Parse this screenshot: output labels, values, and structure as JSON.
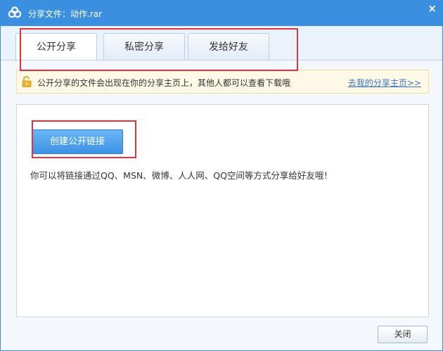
{
  "window": {
    "title": "分享文件：动作.rar",
    "close_glyph": "×",
    "icon": "baidu-cloud-logo-icon"
  },
  "tabs": [
    {
      "label": "公开分享",
      "active": true
    },
    {
      "label": "私密分享",
      "active": false
    },
    {
      "label": "发给好友",
      "active": false
    }
  ],
  "notice": {
    "icon": "unlock-icon",
    "text": "公开分享的文件会出现在你的分享主页上，其他人都可以查看下载哦",
    "link": "去我的分享主页>>"
  },
  "panel": {
    "create_button": "创建公开链接",
    "hint": "你可以将链接通过QQ、MSN、微博、人人网、QQ空间等方式分享给好友哦！"
  },
  "footer": {
    "close_label": "关闭"
  },
  "colors": {
    "titlebar": "#3b8fe0",
    "button_primary": "#3d91e5",
    "link": "#3a74c4",
    "notice_bg": "#fef9e6",
    "highlight": "#e0333b"
  }
}
